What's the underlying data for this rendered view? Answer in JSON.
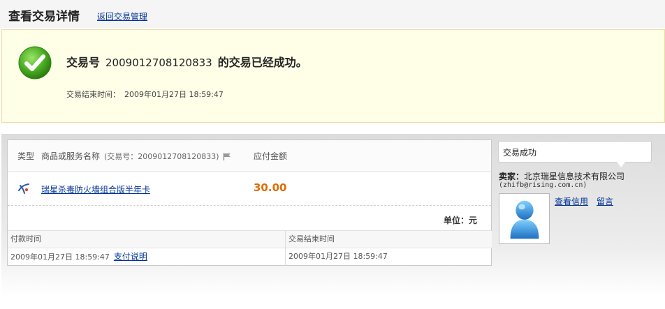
{
  "header": {
    "title": "查看交易详情",
    "back_link": "返回交易管理"
  },
  "success": {
    "prefix": "交易号",
    "trade_no": "2009012708120833",
    "suffix": "的交易已经成功。",
    "end_time_label": "交易结束时间：",
    "end_time_value": "2009年01月27日 18:59:47"
  },
  "detail": {
    "col_type": "类型",
    "col_name": "商品或服务名称",
    "col_trade_no": "(交易号：2009012708120833)",
    "col_amount": "应付金额",
    "item": {
      "name": "瑞星杀毒防火墙组合版半年卡",
      "amount": "30.00"
    },
    "unit": "单位：元",
    "pay_time_label": "付款时间",
    "end_time_label": "交易结束时间",
    "pay_time_value": "2009年01月27日 18:59:47",
    "pay_note_link": "支付说明",
    "end_time_value": "2009年01月27日 18:59:47"
  },
  "seller": {
    "status": "交易成功",
    "label": "卖家：",
    "name": "北京瑞星信息技术有限公司",
    "email": "(zhifb@rising.com.cn)",
    "credit_link": "查看信用",
    "message_link": "留言"
  },
  "colors": {
    "link": "#003399",
    "amount": "#e06c00",
    "success_bg": "#ffffe8",
    "check_green": "#4caf23"
  },
  "icons": {
    "success": "check-circle-icon",
    "flag": "flag-icon",
    "item": "rising-product-icon",
    "avatar": "user-avatar-icon"
  }
}
